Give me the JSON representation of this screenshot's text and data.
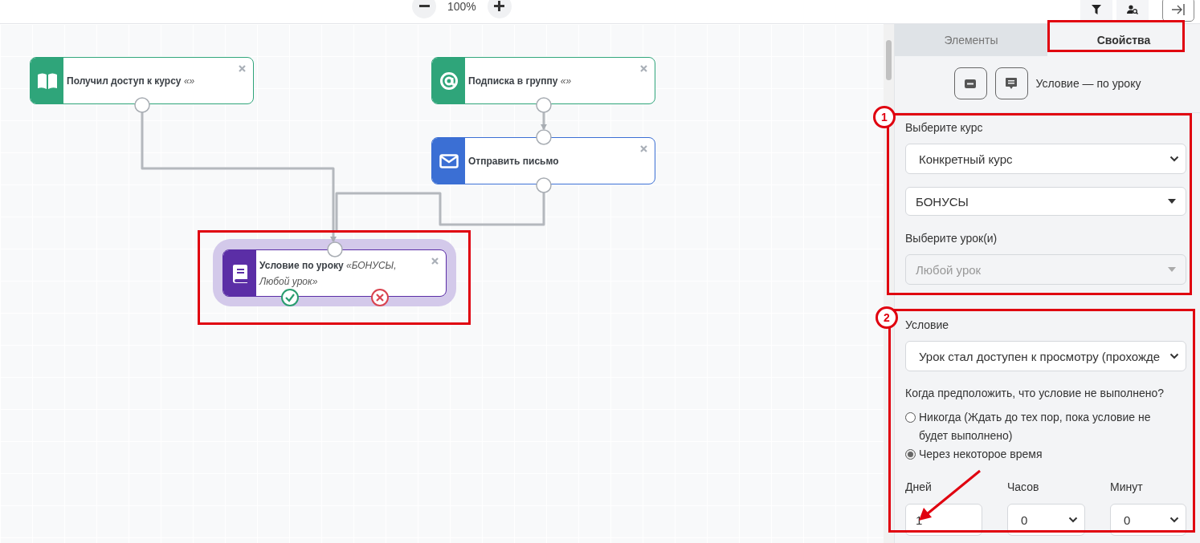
{
  "toolbar": {
    "zoom": "100%"
  },
  "canvas": {
    "nodes": [
      {
        "kind": "course-access",
        "color": "#2fa57a",
        "title": "Получил доступ к курсу",
        "subtitle": "«»",
        "selected": false
      },
      {
        "kind": "subscription",
        "color": "#2fa57a",
        "title": "Подписка в группу",
        "subtitle": "«»",
        "selected": false
      },
      {
        "kind": "email",
        "color": "#3b6fd4",
        "title": "Отправить письмо",
        "selected": false
      },
      {
        "kind": "lesson-condition",
        "color": "#5b2ea6",
        "title": "Условие по уроку",
        "subtitle": "«БОНУСЫ, Любой урок»",
        "selected": true
      }
    ]
  },
  "panel": {
    "tabs": [
      {
        "label": "Элементы",
        "selected": false
      },
      {
        "label": "Свойства",
        "selected": true
      }
    ],
    "header": {
      "title": "Условие — по уроку"
    },
    "course_section": {
      "marker": "1",
      "course_label": "Выберите курс",
      "course_type": "Конкретный курс",
      "course": "БОНУСЫ",
      "lessons_label": "Выберите урок(и)",
      "lessons": {
        "placeholder": "Любой урок",
        "disabled": true
      }
    },
    "condition_section": {
      "marker": "2",
      "condition_label": "Условие",
      "condition": "Урок стал доступен к просмотру (прохожде",
      "question": "Когда предположить, что условие не выполнено?",
      "options": [
        {
          "label": "Никогда (Ждать до тех пор, пока условие не будет выполнено)",
          "selected": false
        },
        {
          "label": "Через некоторое время",
          "selected": true
        }
      ],
      "delay": [
        {
          "kind": "input",
          "label": "Дней",
          "value": "1"
        },
        {
          "kind": "select",
          "label": "Часов",
          "value": "0"
        },
        {
          "kind": "select",
          "label": "Минут",
          "value": "0"
        }
      ]
    }
  }
}
